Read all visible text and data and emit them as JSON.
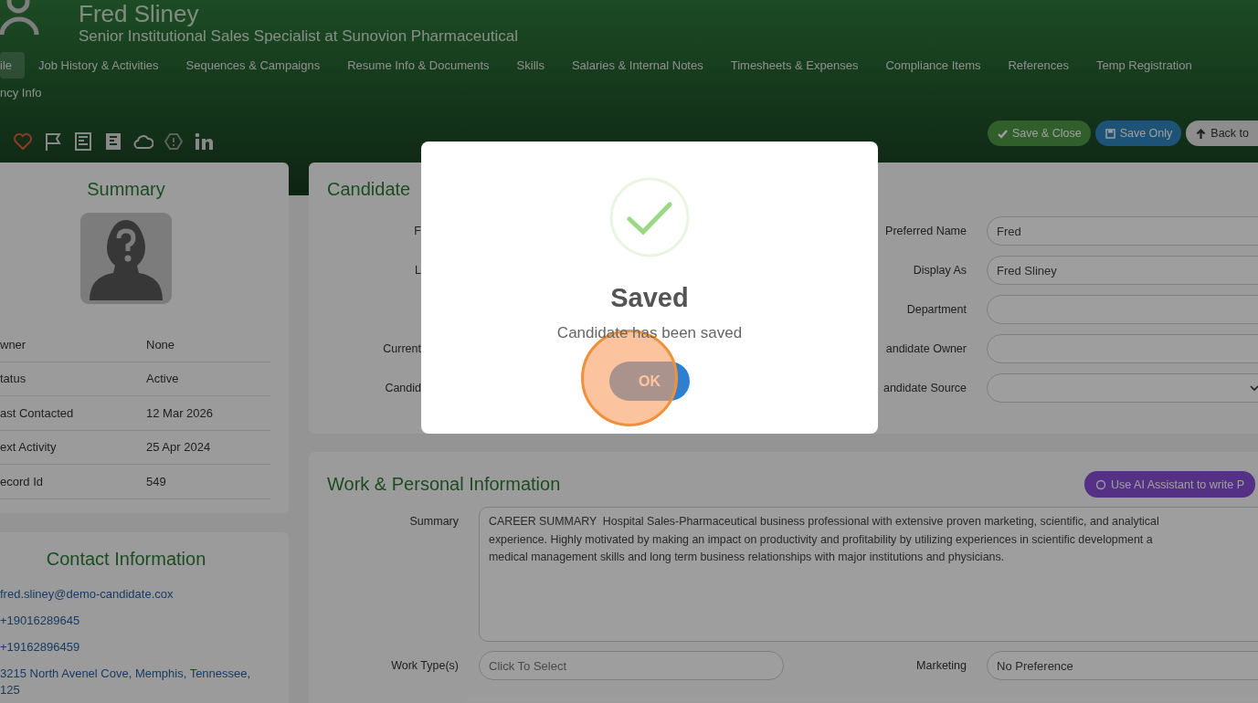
{
  "header": {
    "name": "Fred Sliney",
    "title": "Senior Institutional Sales Specialist at Sunovion Pharmaceutical",
    "tab_rows": [
      [
        {
          "label": "ile",
          "selected": true
        },
        {
          "label": "Job History & Activities",
          "selected": false
        },
        {
          "label": "Sequences & Campaigns",
          "selected": false
        },
        {
          "label": "Resume Info & Documents",
          "selected": false
        },
        {
          "label": "Skills",
          "selected": false
        },
        {
          "label": "Salaries & Internal Notes",
          "selected": false
        },
        {
          "label": "Timesheets & Expenses",
          "selected": false
        },
        {
          "label": "Compliance Items",
          "selected": false
        },
        {
          "label": "References",
          "selected": false
        },
        {
          "label": "Temp Registration",
          "selected": false
        }
      ],
      [
        {
          "label": "ncy Info",
          "selected": false
        }
      ]
    ],
    "action_icons": [
      {
        "kind": "heart"
      },
      {
        "kind": "flag"
      },
      {
        "kind": "document"
      },
      {
        "kind": "document-filled"
      },
      {
        "kind": "cloud"
      },
      {
        "kind": "alert"
      },
      {
        "kind": "linkedin"
      }
    ],
    "buttons": [
      {
        "label": "Save & Close",
        "kind": "save-close"
      },
      {
        "label": "Save Only",
        "kind": "save"
      },
      {
        "label": "Back to",
        "kind": "back"
      }
    ]
  },
  "summary": {
    "title": "Summary",
    "rows": [
      {
        "label": "wner",
        "value": "None"
      },
      {
        "label": "tatus",
        "value": "Active"
      },
      {
        "label": "ast Contacted",
        "value": "12 Mar 2026"
      },
      {
        "label": "ext Activity",
        "value": "25 Apr 2024"
      },
      {
        "label": "ecord Id",
        "value": "549"
      }
    ]
  },
  "contact": {
    "title": "Contact Information",
    "items": [
      "fred.sliney@demo-candidate.cox",
      "+19016289645",
      "+19162896459",
      "3215 North Avenel Cove, Memphis, Tennessee,\n125"
    ]
  },
  "candidate": {
    "title": "Candidate",
    "rows": [
      {
        "left_label": "F",
        "right_label": "Preferred Name",
        "kind": "text",
        "value": "Fred"
      },
      {
        "left_label": "L",
        "right_label": "Display As",
        "kind": "text",
        "value": "Fred Sliney"
      },
      {
        "right_label": "Department",
        "kind": "text"
      },
      {
        "left_label": "Current",
        "right_label": "andidate Owner",
        "kind": "text"
      },
      {
        "left_label": "Candid",
        "right_label": "andidate Source",
        "kind": "select"
      }
    ]
  },
  "work": {
    "title": "Work & Personal Information",
    "ai_button": "Use AI Assistant to write P",
    "summary_label": "Summary",
    "summary_text": "CAREER SUMMARY  Hospital Sales-Pharmaceutical business professional with extensive proven marketing, scientific, and analytical\nexperience. Highly motivated by making an impact on productivity and profitability by utilizing experiences in scientific development a\nmedical management skills and long term business relationships with major institutions and physicians.",
    "rows": [
      {
        "label": "Work Type(s)",
        "placeholder": "Click To Select",
        "right_label": "Marketing",
        "right_value": "No Preference"
      }
    ]
  },
  "dialog": {
    "title": "Saved",
    "message": "Candidate has been saved",
    "button": "OK"
  }
}
